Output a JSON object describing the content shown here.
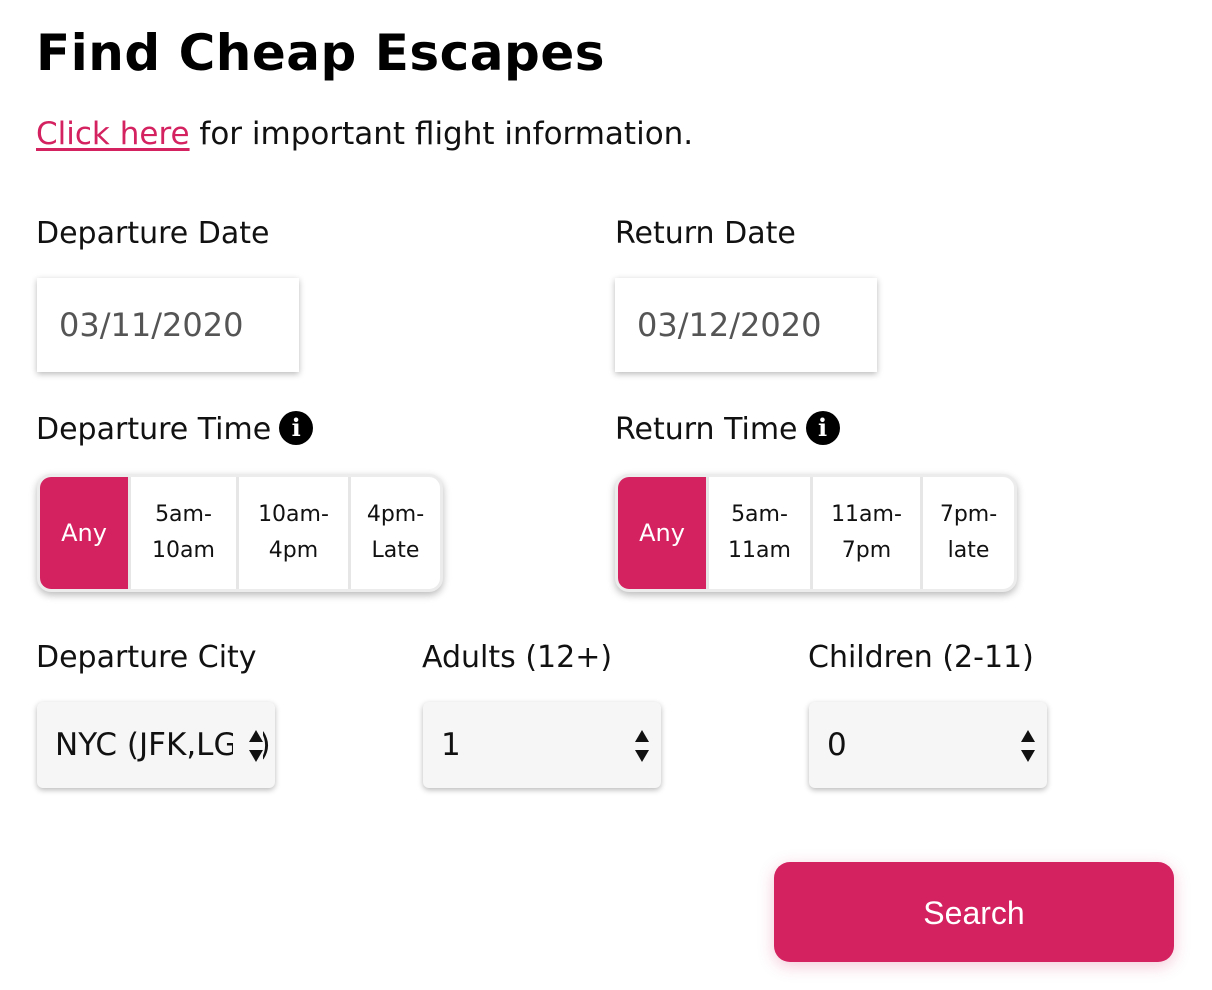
{
  "page_title": "Find Cheap Escapes",
  "info": {
    "link_text": "Click here",
    "rest_text": " for important flight information."
  },
  "departure_date": {
    "label": "Departure Date",
    "value": "03/11/2020"
  },
  "return_date": {
    "label": "Return Date",
    "value": "03/12/2020"
  },
  "departure_time": {
    "label": "Departure Time",
    "info_icon": "info-icon",
    "options": [
      "Any",
      "5am-\n10am",
      "10am-\n4pm",
      "4pm-\nLate"
    ],
    "selected_index": 0
  },
  "return_time": {
    "label": "Return Time",
    "info_icon": "info-icon",
    "options": [
      "Any",
      "5am-\n11am",
      "11am-\n7pm",
      "7pm-\nlate"
    ],
    "selected_index": 0
  },
  "departure_city": {
    "label": "Departure City",
    "value": "NYC (JFK,LGA)"
  },
  "adults": {
    "label": "Adults (12+)",
    "value": "1"
  },
  "children": {
    "label": "Children (2-11)",
    "value": "0"
  },
  "search_button": {
    "label": "Search"
  },
  "colors": {
    "accent": "#d42260",
    "text": "#111111",
    "date_text": "#555555",
    "select_bg": "#f6f6f6"
  }
}
